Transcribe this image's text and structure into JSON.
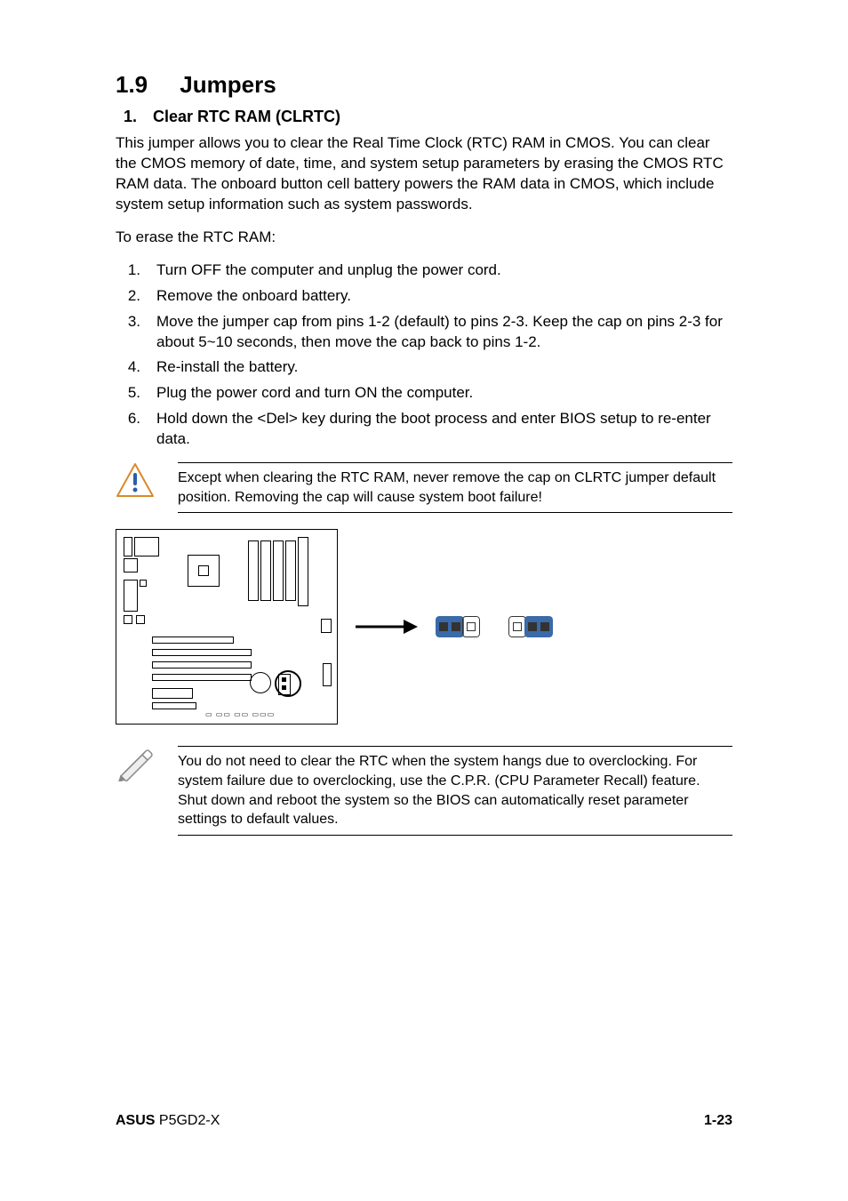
{
  "section": {
    "number": "1.9",
    "title": "Jumpers"
  },
  "item1": {
    "num": "1.",
    "heading": "Clear RTC RAM (CLRTC)",
    "intro": "This jumper allows you to clear the  Real Time Clock (RTC) RAM in CMOS. You can clear the CMOS memory of date, time, and system setup parameters by erasing the CMOS RTC RAM data. The onboard button cell battery powers the RAM data in CMOS, which include system setup information such as system passwords."
  },
  "erase_label": "To erase the RTC RAM:",
  "steps": [
    {
      "n": "1.",
      "t": "Turn OFF the computer and unplug the power cord."
    },
    {
      "n": "2.",
      "t": "Remove the onboard battery."
    },
    {
      "n": "3.",
      "t": "Move the jumper cap from pins 1-2 (default) to pins 2-3. Keep the cap on pins 2-3 for about 5~10 seconds, then move the cap back to pins  1-2."
    },
    {
      "n": "4.",
      "t": "Re-install the battery."
    },
    {
      "n": "5.",
      "t": "Plug the power cord and turn ON the computer."
    },
    {
      "n": "6.",
      "t": "Hold down the <Del> key during the boot process and enter BIOS setup to re-enter data."
    }
  ],
  "warning_note": "Except when clearing the RTC RAM, never remove the cap on CLRTC jumper default position. Removing the cap will cause system boot failure!",
  "pencil_note": "You do not need to clear the RTC when the system hangs due to overclocking. For system failure due to overclocking, use the C.P.R. (CPU Parameter Recall) feature. Shut down and reboot the system so the BIOS can automatically reset parameter settings to default values.",
  "footer": {
    "left_strong": "ASUS",
    "left_rest": " P5GD2-X",
    "right": "1-23"
  }
}
